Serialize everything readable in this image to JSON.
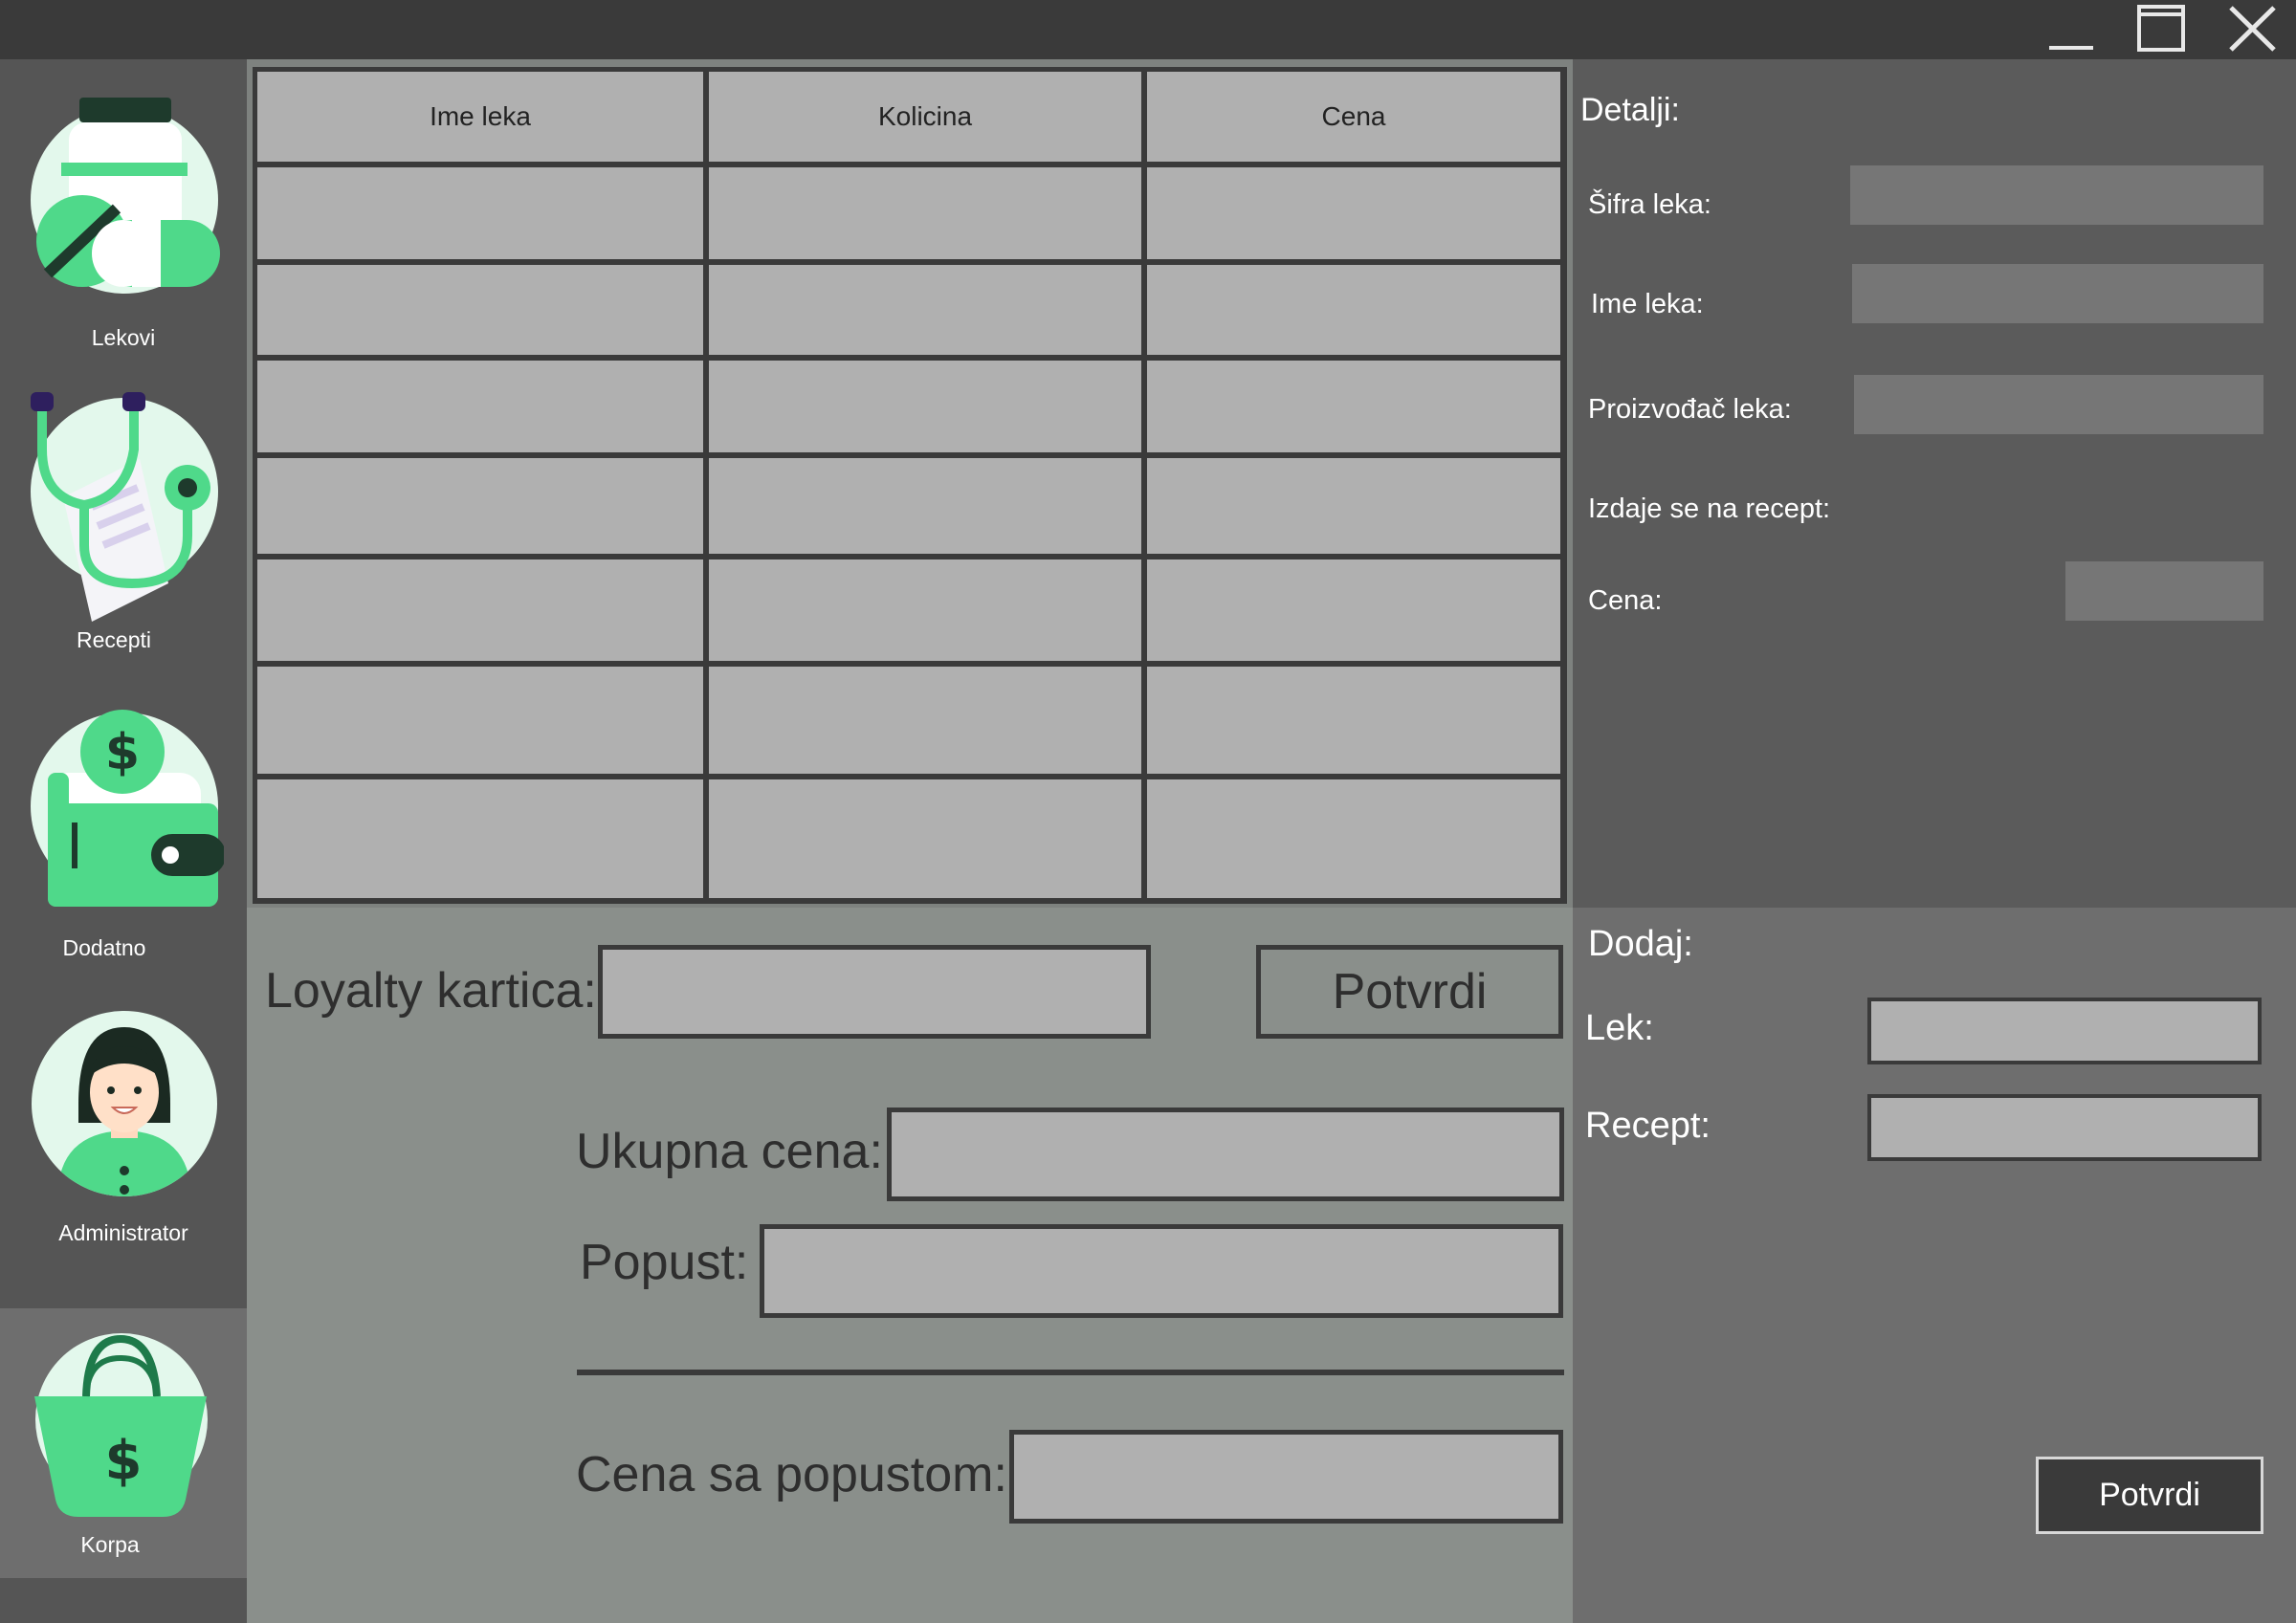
{
  "window": {
    "controls": [
      "minimize-icon",
      "maximize-icon",
      "close-icon"
    ]
  },
  "sidebar": {
    "items": [
      {
        "label": "Lekovi",
        "icon": "pills-icon",
        "active": false
      },
      {
        "label": "Recepti",
        "icon": "stethoscope-prescription-icon",
        "active": false
      },
      {
        "label": "Dodatno",
        "icon": "wallet-coin-icon",
        "active": false
      },
      {
        "label": "Administrator",
        "icon": "admin-avatar-icon",
        "active": false
      },
      {
        "label": "Korpa",
        "icon": "shopping-bag-icon",
        "active": true
      }
    ]
  },
  "table": {
    "columns": [
      "Ime leka",
      "Kolicina",
      "Cena"
    ],
    "rows": [
      [
        "",
        "",
        ""
      ],
      [
        "",
        "",
        ""
      ],
      [
        "",
        "",
        ""
      ],
      [
        "",
        "",
        ""
      ],
      [
        "",
        "",
        ""
      ],
      [
        "",
        "",
        ""
      ],
      [
        "",
        "",
        ""
      ]
    ]
  },
  "cart": {
    "loyalty_label": "Loyalty kartica:",
    "loyalty_value": "",
    "confirm_label": "Potvrdi",
    "total_label": "Ukupna cena:",
    "total_value": "",
    "discount_label": "Popust:",
    "discount_value": "",
    "discounted_label": "Cena sa popustom:",
    "discounted_value": ""
  },
  "details": {
    "title": "Detalji:",
    "code_label": "Šifra leka:",
    "code_value": "",
    "name_label": "Ime leka:",
    "name_value": "",
    "maker_label": "Proizvođač leka:",
    "maker_value": "",
    "prescription_label": "Izdaje se na recept:",
    "price_label": "Cena:",
    "price_value": ""
  },
  "add": {
    "title": "Dodaj:",
    "drug_label": "Lek:",
    "drug_value": "",
    "prescription_label": "Recept:",
    "prescription_value": "",
    "confirm_label": "Potvrdi"
  },
  "colors": {
    "accent": "#4fd98a",
    "accent_dark": "#1e3a2c",
    "icon_bg": "#e3f8ec"
  }
}
